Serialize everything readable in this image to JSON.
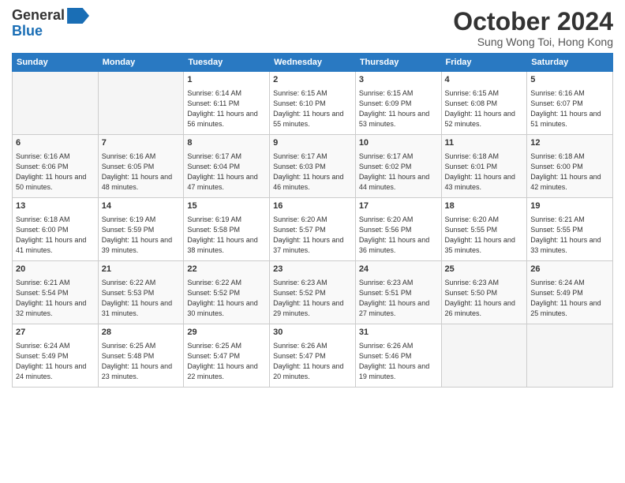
{
  "header": {
    "logo_general": "General",
    "logo_blue": "Blue",
    "month": "October 2024",
    "location": "Sung Wong Toi, Hong Kong"
  },
  "weekdays": [
    "Sunday",
    "Monday",
    "Tuesday",
    "Wednesday",
    "Thursday",
    "Friday",
    "Saturday"
  ],
  "weeks": [
    [
      {
        "day": "",
        "info": ""
      },
      {
        "day": "",
        "info": ""
      },
      {
        "day": "1",
        "info": "Sunrise: 6:14 AM\nSunset: 6:11 PM\nDaylight: 11 hours and 56 minutes."
      },
      {
        "day": "2",
        "info": "Sunrise: 6:15 AM\nSunset: 6:10 PM\nDaylight: 11 hours and 55 minutes."
      },
      {
        "day": "3",
        "info": "Sunrise: 6:15 AM\nSunset: 6:09 PM\nDaylight: 11 hours and 53 minutes."
      },
      {
        "day": "4",
        "info": "Sunrise: 6:15 AM\nSunset: 6:08 PM\nDaylight: 11 hours and 52 minutes."
      },
      {
        "day": "5",
        "info": "Sunrise: 6:16 AM\nSunset: 6:07 PM\nDaylight: 11 hours and 51 minutes."
      }
    ],
    [
      {
        "day": "6",
        "info": "Sunrise: 6:16 AM\nSunset: 6:06 PM\nDaylight: 11 hours and 50 minutes."
      },
      {
        "day": "7",
        "info": "Sunrise: 6:16 AM\nSunset: 6:05 PM\nDaylight: 11 hours and 48 minutes."
      },
      {
        "day": "8",
        "info": "Sunrise: 6:17 AM\nSunset: 6:04 PM\nDaylight: 11 hours and 47 minutes."
      },
      {
        "day": "9",
        "info": "Sunrise: 6:17 AM\nSunset: 6:03 PM\nDaylight: 11 hours and 46 minutes."
      },
      {
        "day": "10",
        "info": "Sunrise: 6:17 AM\nSunset: 6:02 PM\nDaylight: 11 hours and 44 minutes."
      },
      {
        "day": "11",
        "info": "Sunrise: 6:18 AM\nSunset: 6:01 PM\nDaylight: 11 hours and 43 minutes."
      },
      {
        "day": "12",
        "info": "Sunrise: 6:18 AM\nSunset: 6:00 PM\nDaylight: 11 hours and 42 minutes."
      }
    ],
    [
      {
        "day": "13",
        "info": "Sunrise: 6:18 AM\nSunset: 6:00 PM\nDaylight: 11 hours and 41 minutes."
      },
      {
        "day": "14",
        "info": "Sunrise: 6:19 AM\nSunset: 5:59 PM\nDaylight: 11 hours and 39 minutes."
      },
      {
        "day": "15",
        "info": "Sunrise: 6:19 AM\nSunset: 5:58 PM\nDaylight: 11 hours and 38 minutes."
      },
      {
        "day": "16",
        "info": "Sunrise: 6:20 AM\nSunset: 5:57 PM\nDaylight: 11 hours and 37 minutes."
      },
      {
        "day": "17",
        "info": "Sunrise: 6:20 AM\nSunset: 5:56 PM\nDaylight: 11 hours and 36 minutes."
      },
      {
        "day": "18",
        "info": "Sunrise: 6:20 AM\nSunset: 5:55 PM\nDaylight: 11 hours and 35 minutes."
      },
      {
        "day": "19",
        "info": "Sunrise: 6:21 AM\nSunset: 5:55 PM\nDaylight: 11 hours and 33 minutes."
      }
    ],
    [
      {
        "day": "20",
        "info": "Sunrise: 6:21 AM\nSunset: 5:54 PM\nDaylight: 11 hours and 32 minutes."
      },
      {
        "day": "21",
        "info": "Sunrise: 6:22 AM\nSunset: 5:53 PM\nDaylight: 11 hours and 31 minutes."
      },
      {
        "day": "22",
        "info": "Sunrise: 6:22 AM\nSunset: 5:52 PM\nDaylight: 11 hours and 30 minutes."
      },
      {
        "day": "23",
        "info": "Sunrise: 6:23 AM\nSunset: 5:52 PM\nDaylight: 11 hours and 29 minutes."
      },
      {
        "day": "24",
        "info": "Sunrise: 6:23 AM\nSunset: 5:51 PM\nDaylight: 11 hours and 27 minutes."
      },
      {
        "day": "25",
        "info": "Sunrise: 6:23 AM\nSunset: 5:50 PM\nDaylight: 11 hours and 26 minutes."
      },
      {
        "day": "26",
        "info": "Sunrise: 6:24 AM\nSunset: 5:49 PM\nDaylight: 11 hours and 25 minutes."
      }
    ],
    [
      {
        "day": "27",
        "info": "Sunrise: 6:24 AM\nSunset: 5:49 PM\nDaylight: 11 hours and 24 minutes."
      },
      {
        "day": "28",
        "info": "Sunrise: 6:25 AM\nSunset: 5:48 PM\nDaylight: 11 hours and 23 minutes."
      },
      {
        "day": "29",
        "info": "Sunrise: 6:25 AM\nSunset: 5:47 PM\nDaylight: 11 hours and 22 minutes."
      },
      {
        "day": "30",
        "info": "Sunrise: 6:26 AM\nSunset: 5:47 PM\nDaylight: 11 hours and 20 minutes."
      },
      {
        "day": "31",
        "info": "Sunrise: 6:26 AM\nSunset: 5:46 PM\nDaylight: 11 hours and 19 minutes."
      },
      {
        "day": "",
        "info": ""
      },
      {
        "day": "",
        "info": ""
      }
    ]
  ]
}
